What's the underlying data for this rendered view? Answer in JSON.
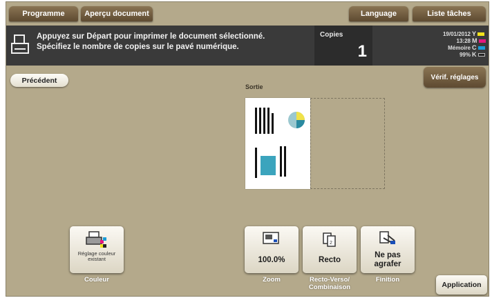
{
  "top_tabs": {
    "programme": "Programme",
    "apercu": "Aperçu document",
    "language": "Language",
    "liste_taches": "Liste tâches"
  },
  "message": {
    "line1": "Appuyez sur Départ pour imprimer le document sélectionné.",
    "line2": "Spécifiez le nombre de copies sur le pavé numérique.",
    "icon": "printer-icon"
  },
  "copies": {
    "label": "Copies",
    "value": "1"
  },
  "status": {
    "date": "19/01/2012",
    "time": "13:28",
    "memory_label": "Mémoire",
    "memory_value": "99%",
    "toner": [
      {
        "label": "Y",
        "color": "#f2e21b"
      },
      {
        "label": "M",
        "color": "#e6177e"
      },
      {
        "label": "C",
        "color": "#1a9cd8"
      },
      {
        "label": "K",
        "color": "#222222"
      }
    ]
  },
  "precedent": "Précédent",
  "verif_reglages": "Vérif. réglages",
  "preview": {
    "label": "Sortie"
  },
  "functions": {
    "couleur": {
      "text": "Réglage couleur existant",
      "caption": "Couleur",
      "icon": "color-printer-icon"
    },
    "zoom": {
      "value": "100.0%",
      "caption": "Zoom",
      "icon": "zoom-icon"
    },
    "recto": {
      "value": "Recto",
      "caption_line1": "Recto-Verso/",
      "caption_line2": "Combinaison",
      "icon": "duplex-icon"
    },
    "finition": {
      "value_line1": "Ne pas",
      "value_line2": "agrafer",
      "caption": "Finition",
      "icon": "staple-icon"
    }
  },
  "application": "Application"
}
